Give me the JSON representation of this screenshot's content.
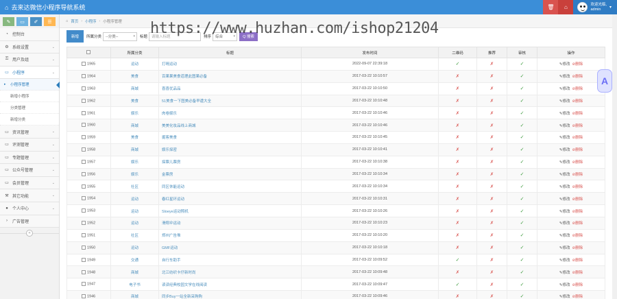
{
  "header": {
    "title": "去来达微信小程序导航系统",
    "welcome": "欢迎光临,",
    "username": "admin"
  },
  "sidebar": {
    "items": [
      {
        "label": "控制台",
        "icon": "dashboard-icon"
      },
      {
        "label": "系统设置",
        "icon": "gear-icon"
      },
      {
        "label": "用户及组",
        "icon": "key-icon"
      },
      {
        "label": "小程序",
        "icon": "monitor-icon",
        "active": true,
        "sub": [
          "小程序管理",
          "新增小程序",
          "分类管理",
          "新增分类"
        ]
      },
      {
        "label": "资讯管理",
        "icon": "monitor-icon"
      },
      {
        "label": "评测管理",
        "icon": "monitor-icon"
      },
      {
        "label": "专题管理",
        "icon": "monitor-icon"
      },
      {
        "label": "公众号管理",
        "icon": "monitor-icon"
      },
      {
        "label": "会员管理",
        "icon": "monitor-icon"
      },
      {
        "label": "其它功能",
        "icon": "wrench-icon"
      },
      {
        "label": "个人中心",
        "icon": "user-icon"
      },
      {
        "label": "广告管理",
        "icon": "caret-right-icon"
      }
    ]
  },
  "breadcrumb": {
    "home": "首页",
    "level1": "小程序",
    "level2": "小程序管理"
  },
  "filter": {
    "add_label": "新增",
    "category_label": "所属分类",
    "category_value": "--分类--",
    "title_label": "标题",
    "title_placeholder": "请输入标题",
    "sort_label": "排序",
    "sort_value": "综合",
    "search_label": "Q 搜索"
  },
  "watermark": "https://www.huzhan.com/ishop21204",
  "table": {
    "headers": [
      "",
      "所属分类",
      "标题",
      "发布时间",
      "二维码",
      "推荐",
      "审核",
      "操作"
    ],
    "edit_label": "✎修改",
    "delete_label": "⊘删除",
    "rows": [
      {
        "id": "1965",
        "category": "运动",
        "title": "打嗝运动",
        "date": "2022-09-07 22:39:18",
        "qr": true,
        "rec": false,
        "audit": true
      },
      {
        "id": "1964",
        "category": "美食",
        "title": "百果果美食道理此图果必备",
        "date": "2017-03-22 10:10:57",
        "qr": false,
        "rec": false,
        "audit": true
      },
      {
        "id": "1963",
        "category": "商城",
        "title": "喜喜优品品",
        "date": "2017-03-22 10:10:50",
        "qr": false,
        "rec": false,
        "audit": true
      },
      {
        "id": "1962",
        "category": "美食",
        "title": "51美食一下图美必备早遭大全",
        "date": "2017-03-22 10:10:48",
        "qr": false,
        "rec": false,
        "audit": true
      },
      {
        "id": "1961",
        "category": "娱乐",
        "title": "肉卷娱乐",
        "date": "2017-03-22 10:10:46",
        "qr": false,
        "rec": false,
        "audit": true
      },
      {
        "id": "1960",
        "category": "商城",
        "title": "美美化妆品线上商城",
        "date": "2017-03-22 10:10:46",
        "qr": false,
        "rec": false,
        "audit": true
      },
      {
        "id": "1959",
        "category": "美食",
        "title": "掘客美食",
        "date": "2017-03-22 10:10:45",
        "qr": false,
        "rec": false,
        "audit": true
      },
      {
        "id": "1958",
        "category": "商城",
        "title": "娱乐探密",
        "date": "2017-03-22 10:10:41",
        "qr": false,
        "rec": false,
        "audit": true
      },
      {
        "id": "1957",
        "category": "娱乐",
        "title": "探票儿票房",
        "date": "2017-03-22 10:10:38",
        "qr": false,
        "rec": false,
        "audit": true
      },
      {
        "id": "1956",
        "category": "娱乐",
        "title": "金票房",
        "date": "2017-03-22 10:10:34",
        "qr": false,
        "rec": false,
        "audit": true
      },
      {
        "id": "1955",
        "category": "社区",
        "title": "同区休能运动",
        "date": "2017-03-22 10:10:34",
        "qr": false,
        "rec": false,
        "audit": true
      },
      {
        "id": "1954",
        "category": "运动",
        "title": "春红星环运动",
        "date": "2017-03-22 10:10:31",
        "qr": false,
        "rec": false,
        "audit": true
      },
      {
        "id": "1953",
        "category": "运动",
        "title": "Sloeye运动照机",
        "date": "2017-03-22 10:10:26",
        "qr": false,
        "rec": false,
        "audit": true
      },
      {
        "id": "1952",
        "category": "运动",
        "title": "滑翔伞运动",
        "date": "2017-03-22 10:10:23",
        "qr": false,
        "rec": false,
        "audit": true
      },
      {
        "id": "1951",
        "category": "社区",
        "title": "郑州广告堆",
        "date": "2017-03-22 10:10:20",
        "qr": false,
        "rec": false,
        "audit": true
      },
      {
        "id": "1950",
        "category": "运动",
        "title": "GMF运动",
        "date": "2017-03-22 10:10:18",
        "qr": false,
        "rec": false,
        "audit": true
      },
      {
        "id": "1949",
        "category": "交通",
        "title": "自行车助手",
        "date": "2017-03-22 10:09:52",
        "qr": true,
        "rec": false,
        "audit": true
      },
      {
        "id": "1948",
        "category": "商城",
        "title": "北江纺织卡仔新时尚",
        "date": "2017-03-22 10:09:48",
        "qr": false,
        "rec": false,
        "audit": true
      },
      {
        "id": "1947",
        "category": "电子书",
        "title": "读读经典校园文学在线阅读",
        "date": "2017-03-22 10:09:47",
        "qr": true,
        "rec": false,
        "audit": true
      },
      {
        "id": "1946",
        "category": "商城",
        "title": "同步Buy一站全新采购购",
        "date": "2017-03-22 10:09:46",
        "qr": false,
        "rec": false,
        "audit": true
      }
    ]
  },
  "colors": {
    "topbar": "#3b8ed8",
    "accent": "#428bca",
    "ok": "#3c9a3c",
    "no": "#d9534f"
  }
}
